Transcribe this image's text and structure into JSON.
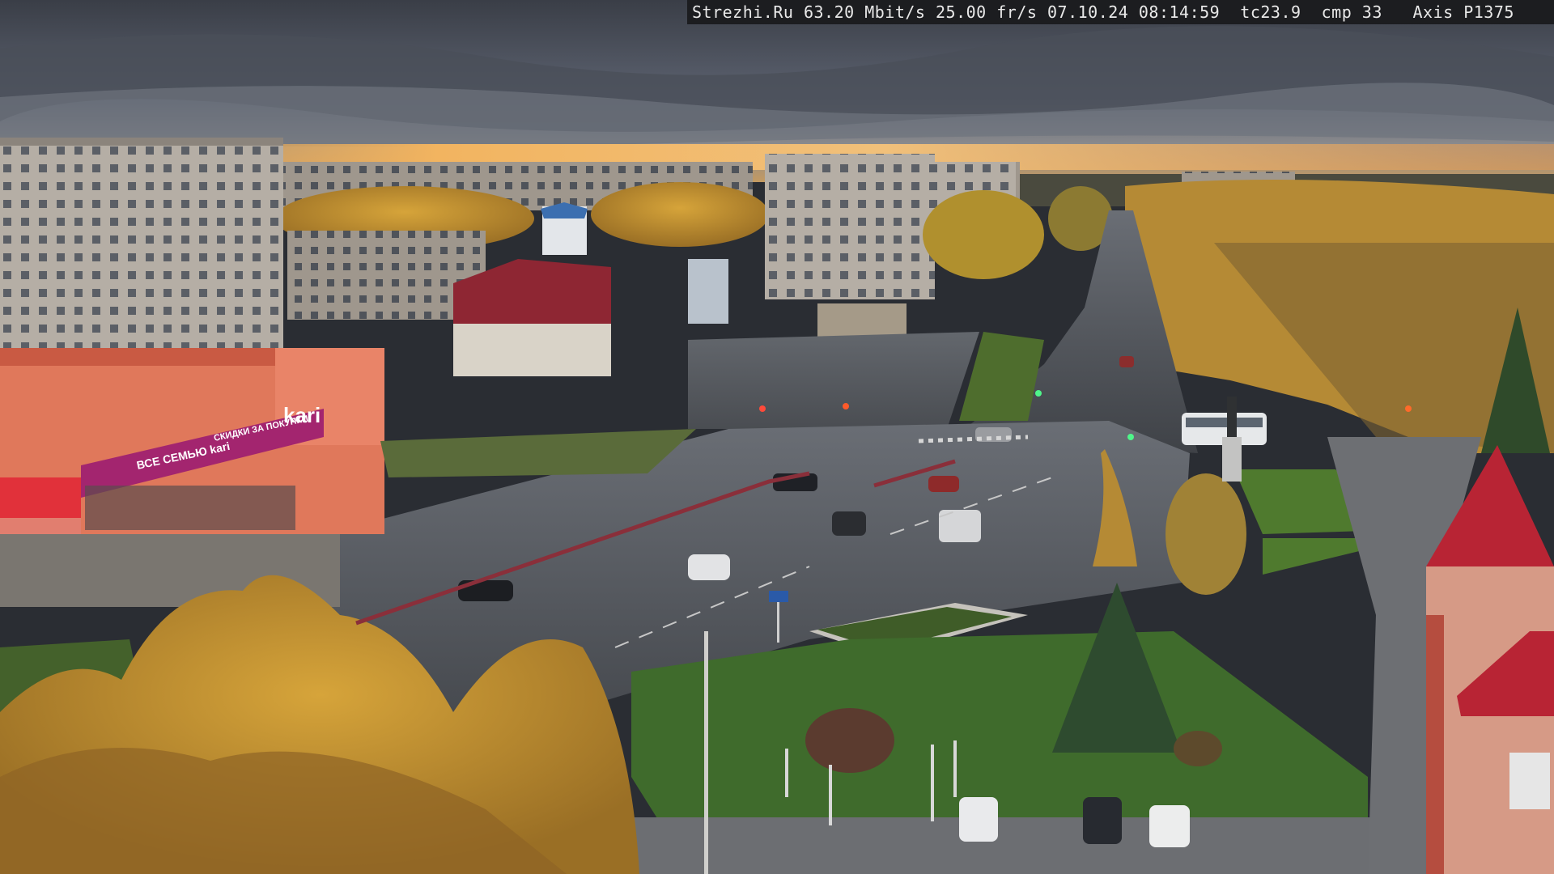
{
  "osd": {
    "site": "Strezhi.Ru",
    "bitrate": "63.20 Mbit/s",
    "framerate": "25.00 fr/s",
    "date": "07.10.24",
    "time": "08:14:59",
    "temp": "tc23.9",
    "compression": "cmp 33",
    "camera": "Axis P1375"
  },
  "signs": {
    "store_logo": "kari",
    "store_small": "ВСЕ СЕМЬЮ kari",
    "store_banner": "СКИДКИ ЗА ПОКУПКИ"
  },
  "colors": {
    "sky_top": "#3b4049",
    "sky_mid": "#5c6270",
    "sunset": "#f0b25a",
    "road": "#4d5157",
    "grass": "#3f6b2c",
    "foliage": "#c79631",
    "kari_magenta": "#a3256f"
  }
}
